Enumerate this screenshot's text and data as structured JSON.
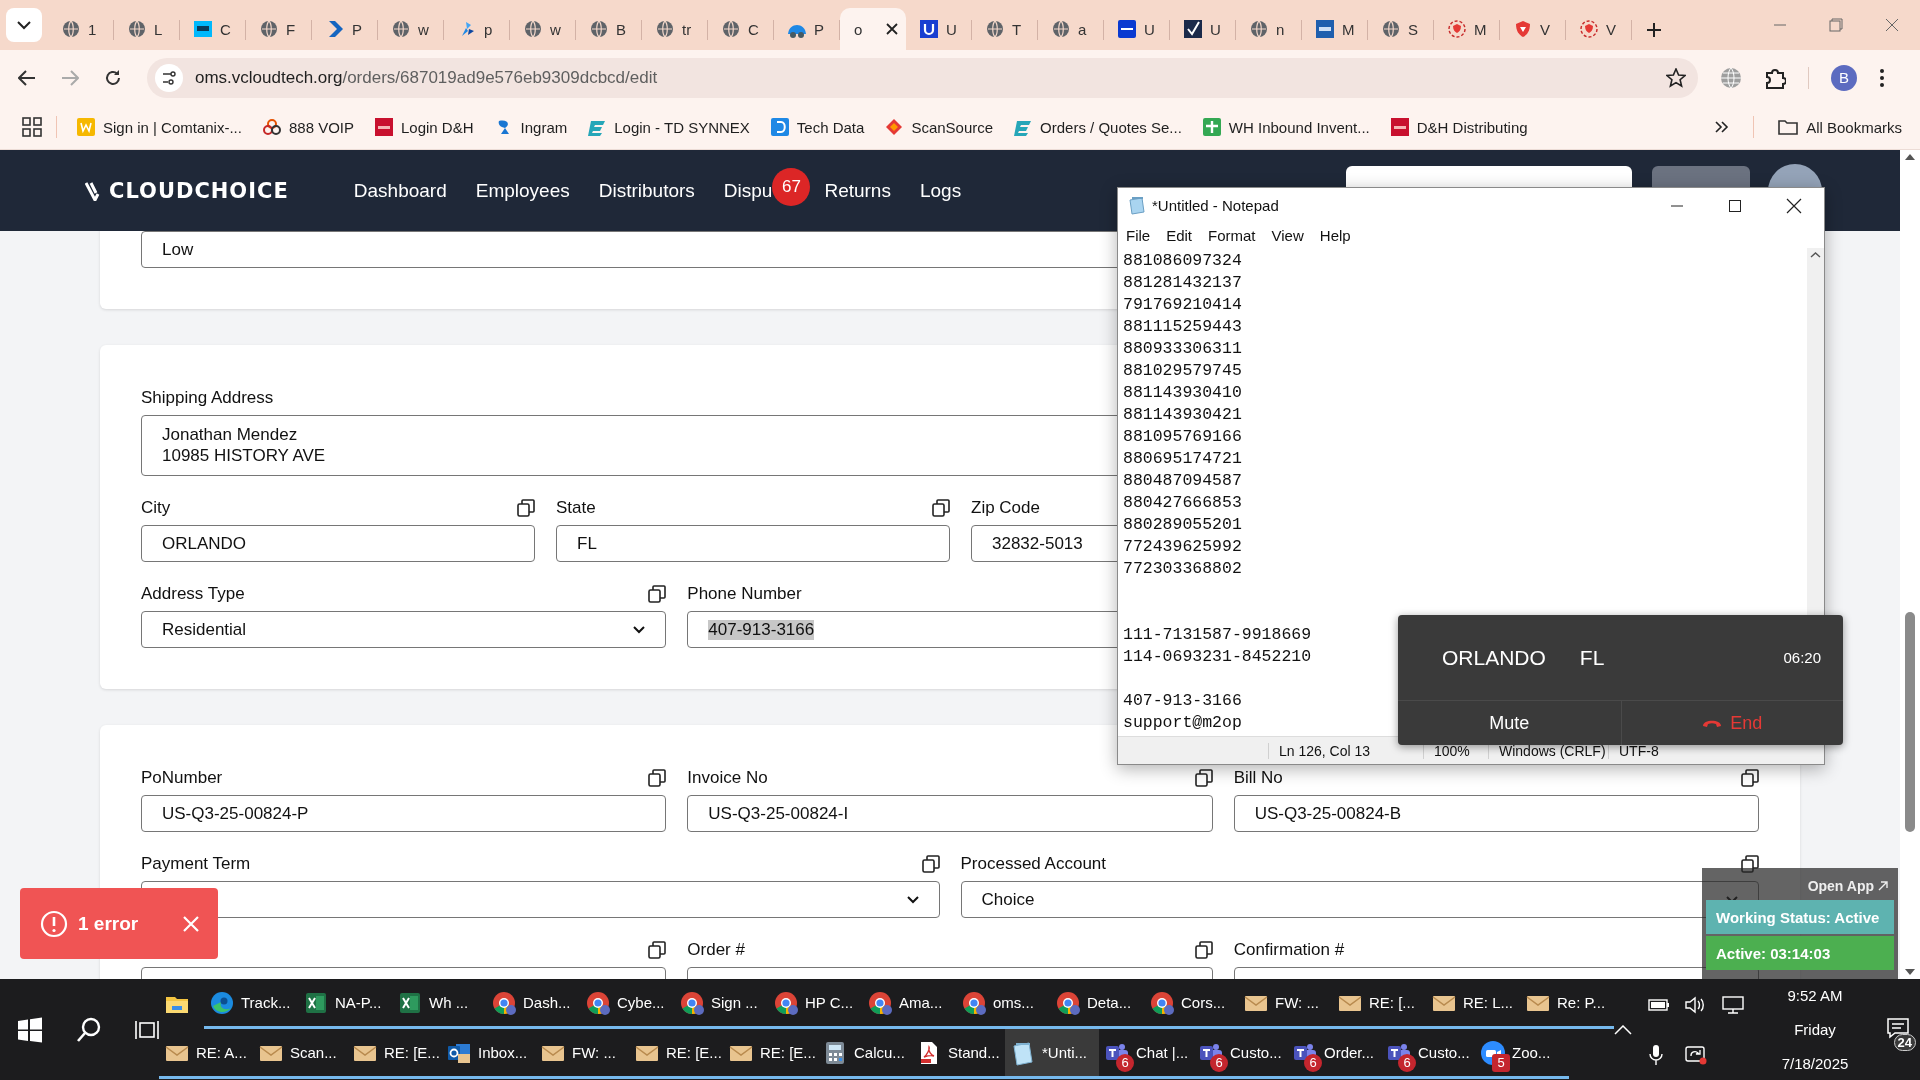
{
  "browser": {
    "tabs": [
      {
        "title": "1",
        "kind": "globe",
        "selected": false
      },
      {
        "title": "L",
        "kind": "globe",
        "selected": false
      },
      {
        "title": "C",
        "kind": "logi",
        "selected": false
      },
      {
        "title": "F",
        "kind": "globe",
        "selected": false
      },
      {
        "title": "P",
        "kind": "arrow",
        "selected": false
      },
      {
        "title": "w",
        "kind": "globe",
        "selected": false
      },
      {
        "title": "p",
        "kind": "pinwheel",
        "selected": false
      },
      {
        "title": "w",
        "kind": "globe",
        "selected": false
      },
      {
        "title": "B",
        "kind": "globe",
        "selected": false
      },
      {
        "title": "tr",
        "kind": "globe",
        "selected": false
      },
      {
        "title": "C",
        "kind": "globe",
        "selected": false
      },
      {
        "title": "P",
        "kind": "car",
        "selected": false
      },
      {
        "title": "o",
        "kind": "blank",
        "selected": true
      },
      {
        "title": "U",
        "kind": "ublue",
        "selected": false
      },
      {
        "title": "T",
        "kind": "globe",
        "selected": false
      },
      {
        "title": "a",
        "kind": "globe",
        "selected": false
      },
      {
        "title": "U",
        "kind": "brother",
        "selected": false
      },
      {
        "title": "U",
        "kind": "check",
        "selected": false
      },
      {
        "title": "n",
        "kind": "globe",
        "selected": false
      },
      {
        "title": "M",
        "kind": "etn",
        "selected": false
      },
      {
        "title": "S",
        "kind": "globe",
        "selected": false
      },
      {
        "title": "M",
        "kind": "ring",
        "selected": false
      },
      {
        "title": "V",
        "kind": "shield",
        "selected": false
      },
      {
        "title": "V",
        "kind": "ring",
        "selected": false
      }
    ],
    "url_host": "oms.vcloudtech.org",
    "url_path": "/orders/687019ad9e576eb9309dcbcd/edit",
    "profile_initial": "B",
    "bookmarks": [
      {
        "label": "Sign in | Comtanix-...",
        "kind": "yellow"
      },
      {
        "label": "888 VOIP",
        "kind": "rings"
      },
      {
        "label": "Login D&H",
        "kind": "red"
      },
      {
        "label": "Ingram",
        "kind": "swoosh"
      },
      {
        "label": "Login - TD SYNNEX",
        "kind": "teal"
      },
      {
        "label": "Tech Data",
        "kind": "blue"
      },
      {
        "label": "ScanSource",
        "kind": "diamond"
      },
      {
        "label": "Orders / Quotes Se...",
        "kind": "teal"
      },
      {
        "label": "WH Inbound Invent...",
        "kind": "sheet"
      },
      {
        "label": "D&H Distributing",
        "kind": "red"
      }
    ],
    "all_bookmarks": "All Bookmarks"
  },
  "app": {
    "logo": "CLOUDCHOICE",
    "nav": [
      {
        "label": "Dashboard"
      },
      {
        "label": "Employees"
      },
      {
        "label": "Distributors"
      },
      {
        "label": "Dispu",
        "badge": "67"
      },
      {
        "label": "Returns"
      },
      {
        "label": "Logs"
      }
    ]
  },
  "form": {
    "cards": [
      {
        "rows": [
          {
            "kind": "full",
            "fields": [
              {
                "kind": "input",
                "value": "Low",
                "copy": false
              }
            ]
          }
        ]
      },
      {
        "rows": [
          {
            "kind": "full",
            "fields": [
              {
                "kind": "textarea",
                "label": "Shipping Address",
                "lines": [
                  "Jonathan Mendez",
                  "10985 HISTORY AVE"
                ],
                "copy": false
              }
            ]
          },
          {
            "kind": "quarters",
            "fields": [
              {
                "kind": "input",
                "label": "City",
                "value": "ORLANDO",
                "copy": true
              },
              {
                "kind": "input",
                "label": "State",
                "value": "FL",
                "copy": true
              },
              {
                "kind": "input",
                "label": "Zip Code",
                "value": "32832-5013",
                "copy": false
              }
            ]
          },
          {
            "kind": "thirds",
            "fields": [
              {
                "kind": "select",
                "label": "Address Type",
                "value": "Residential",
                "copy": true
              },
              {
                "kind": "input",
                "label": "Phone Number",
                "value": "407-913-3166",
                "highlighted": true,
                "copy": false
              }
            ]
          }
        ]
      },
      {
        "rows": [
          {
            "kind": "thirds",
            "fields": [
              {
                "kind": "input",
                "label": "PoNumber",
                "value": "US-Q3-25-00824-P",
                "copy": true
              },
              {
                "kind": "input",
                "label": "Invoice No",
                "value": "US-Q3-25-00824-I",
                "copy": true
              },
              {
                "kind": "input",
                "label": "Bill No",
                "value": "US-Q3-25-00824-B",
                "copy": true
              }
            ]
          },
          {
            "kind": "halves",
            "fields": [
              {
                "kind": "select",
                "label": "Payment Term",
                "copy": true
              },
              {
                "kind": "select",
                "label": "Processed Account",
                "value": "Choice",
                "copy": true
              }
            ]
          },
          {
            "kind": "thirds",
            "fields": [
              {
                "kind": "input",
                "copy": true
              },
              {
                "kind": "input",
                "label": "Order #",
                "copy": true
              },
              {
                "kind": "input",
                "label": "Confirmation #",
                "copy": false
              }
            ]
          }
        ]
      }
    ]
  },
  "notepad": {
    "title": "*Untitled - Notepad",
    "menu": [
      "File",
      "Edit",
      "Format",
      "View",
      "Help"
    ],
    "blocks": [
      {
        "lines": [
          "881086097324",
          "881281432137",
          "791769210414",
          "881115259443",
          "880933306311",
          "881029579745",
          "881143930410",
          "881143930421",
          "881095769166",
          "880695174721",
          "880487094587",
          "880427666853",
          "880289055201",
          "772439625992",
          "772303368802"
        ]
      },
      {
        "lines": [
          "111-7131587-9918669",
          "114-0693231-8452210"
        ]
      },
      {
        "lines": [
          "407-913-3166",
          "support@m2op"
        ]
      }
    ],
    "status": [
      "Ln 126, Col 13",
      "100%",
      "Windows (CRLF)",
      "UTF-8"
    ]
  },
  "call": {
    "city": "ORLANDO",
    "state": "FL",
    "timer": "06:20",
    "buttons": [
      {
        "label": "Mute",
        "kind": "mute"
      },
      {
        "label": "End",
        "kind": "end"
      }
    ]
  },
  "toast": {
    "message": "1 error"
  },
  "widget": {
    "open_app": "Open App",
    "working_status": "Working Status: Active",
    "active_time": "Active: 03:14:03"
  },
  "taskbar": {
    "rows": [
      [
        {
          "kind": "explorer",
          "selected": false
        },
        {
          "kind": "edge",
          "label": "Track...",
          "selected": false
        },
        {
          "kind": "excel",
          "label": "NA-P...",
          "selected": false
        },
        {
          "kind": "excel",
          "label": "Wh ...",
          "selected": false
        },
        {
          "kind": "chrome",
          "label": "Dash...",
          "selected": false
        },
        {
          "kind": "chrome",
          "label": "Cybe...",
          "selected": false
        },
        {
          "kind": "chrome",
          "label": "Sign ...",
          "selected": false
        },
        {
          "kind": "chrome",
          "label": "HP C...",
          "selected": false
        },
        {
          "kind": "chrome",
          "label": "Ama...",
          "selected": false
        },
        {
          "kind": "chrome",
          "label": "oms...",
          "selected": false
        },
        {
          "kind": "chrome",
          "label": "Deta...",
          "selected": false
        },
        {
          "kind": "chrome",
          "label": "Cors...",
          "selected": false
        },
        {
          "kind": "mail",
          "label": "FW: ...",
          "selected": false
        },
        {
          "kind": "mail",
          "label": "RE: [...",
          "selected": false
        },
        {
          "kind": "mail",
          "label": "RE: L...",
          "selected": false
        },
        {
          "kind": "mail",
          "label": "Re: P...",
          "selected": false
        }
      ],
      [
        {
          "kind": "mail",
          "label": "RE: A...",
          "selected": false
        },
        {
          "kind": "mail",
          "label": "Scan...",
          "selected": false
        },
        {
          "kind": "mail",
          "label": "RE: [E...",
          "selected": false
        },
        {
          "kind": "outlook",
          "label": "Inbox...",
          "selected": false
        },
        {
          "kind": "mail",
          "label": "FW: ...",
          "selected": false
        },
        {
          "kind": "mail",
          "label": "RE: [E...",
          "selected": false
        },
        {
          "kind": "mail",
          "label": "RE: [E...",
          "selected": false
        },
        {
          "kind": "calculator",
          "label": "Calcu...",
          "selected": false
        },
        {
          "kind": "pdf",
          "label": "Stand...",
          "selected": false
        },
        {
          "kind": "notepad",
          "label": "*Unti...",
          "selected": true
        },
        {
          "kind": "teams",
          "label": "Chat |...",
          "badge": "6",
          "selected": false
        },
        {
          "kind": "teams",
          "label": "Custo...",
          "badge": "6",
          "selected": false
        },
        {
          "kind": "teams",
          "label": "Order...",
          "badge": "6",
          "selected": false
        },
        {
          "kind": "teams",
          "label": "Custo...",
          "badge": "6",
          "selected": false
        },
        {
          "kind": "zoom",
          "label": "Zoo...",
          "badge": "5",
          "selected": false
        }
      ]
    ],
    "time": "9:52 AM",
    "day": "Friday",
    "date": "7/18/2025",
    "notifications": "24"
  }
}
